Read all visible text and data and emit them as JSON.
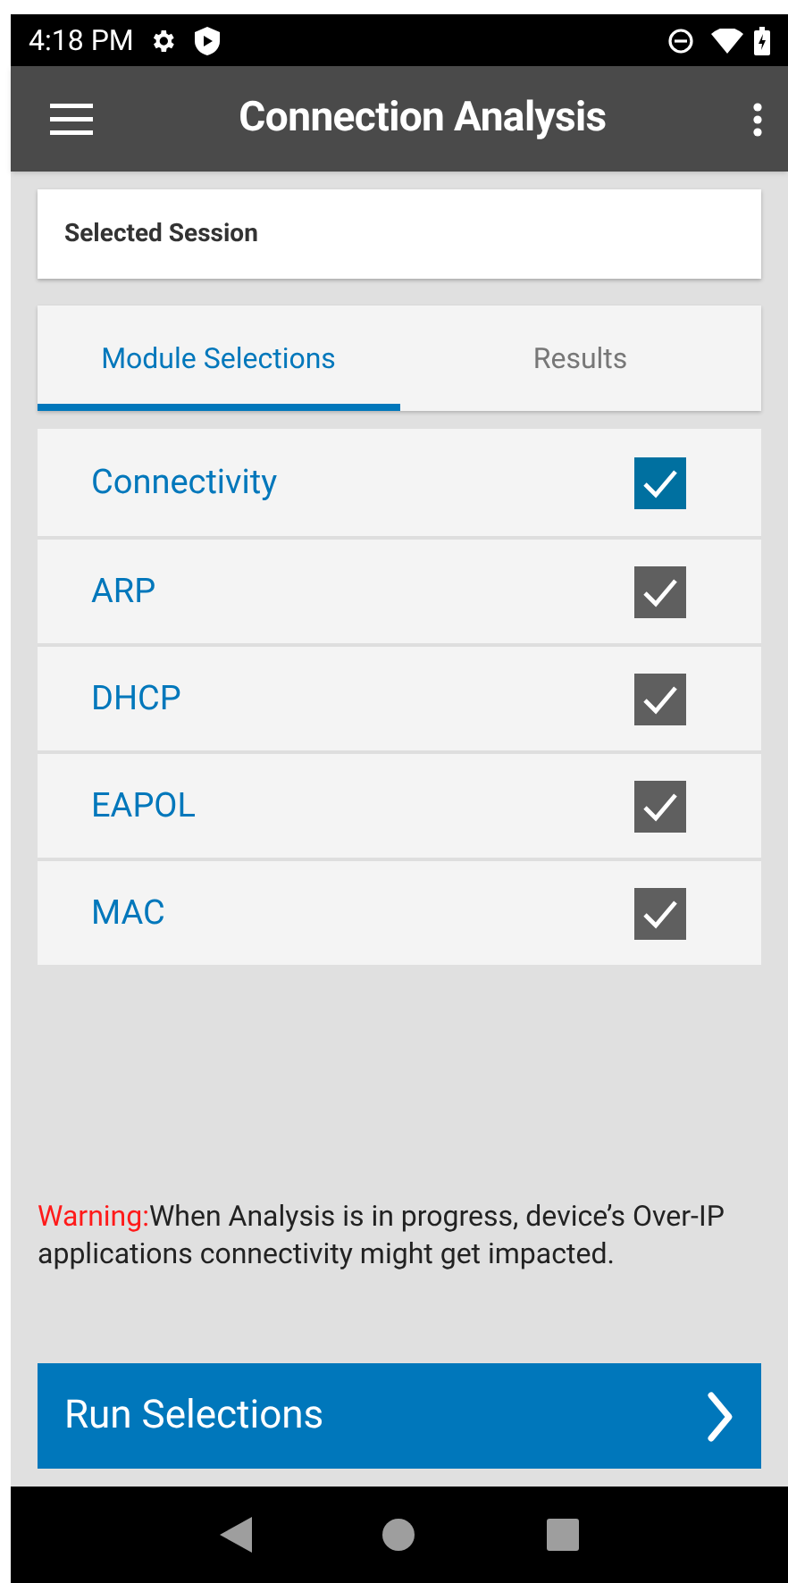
{
  "status_bar": {
    "time": "4:18 PM"
  },
  "app_bar": {
    "title": "Connection Analysis"
  },
  "session": {
    "label": "Selected Session"
  },
  "tabs": [
    {
      "label": "Module Selections",
      "selected": true
    },
    {
      "label": "Results",
      "selected": false
    }
  ],
  "modules": [
    {
      "label": "Connectivity",
      "checked": true,
      "color": "#0070a0"
    },
    {
      "label": "ARP",
      "checked": true,
      "color": "#5f5f5f"
    },
    {
      "label": "DHCP",
      "checked": true,
      "color": "#5f5f5f"
    },
    {
      "label": "EAPOL",
      "checked": true,
      "color": "#5f5f5f"
    },
    {
      "label": "MAC",
      "checked": true,
      "color": "#5f5f5f"
    }
  ],
  "warning": {
    "label": "Warning:",
    "text": "When Analysis is in progress, device’s Over-IP applications connectivity might get impacted."
  },
  "run_button": {
    "label": "Run Selections"
  }
}
